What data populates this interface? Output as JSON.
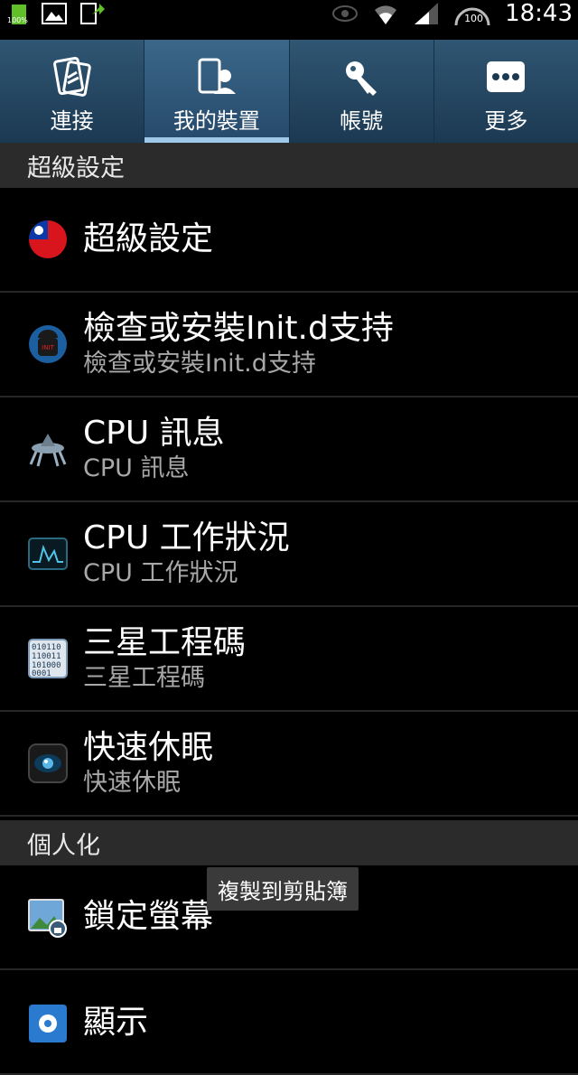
{
  "statusbar": {
    "battery_label": "100%",
    "speed_gauge_value": "100",
    "time": "18:43"
  },
  "tabs": [
    {
      "label": "連接",
      "icon": "connection-icon",
      "active": false
    },
    {
      "label": "我的裝置",
      "icon": "my-device-icon",
      "active": true
    },
    {
      "label": "帳號",
      "icon": "account-key-icon",
      "active": false
    },
    {
      "label": "更多",
      "icon": "more-icon",
      "active": false
    }
  ],
  "sections": {
    "super_settings": "超級設定",
    "personalization": "個人化"
  },
  "items": [
    {
      "title": "超級設定",
      "subtitle": "",
      "icon": "taiwan-flag-icon"
    },
    {
      "title": "檢查或安裝Init.d支持",
      "subtitle": "檢查或安裝Init.d支持",
      "icon": "android-robot-icon"
    },
    {
      "title": "CPU 訊息",
      "subtitle": "CPU 訊息",
      "icon": "cpu-spider-icon"
    },
    {
      "title": "CPU 工作狀況",
      "subtitle": "CPU 工作狀況",
      "icon": "cpu-monitor-icon"
    },
    {
      "title": "三星工程碼",
      "subtitle": "三星工程碼",
      "icon": "binary-code-icon"
    },
    {
      "title": "快速休眠",
      "subtitle": "快速休眠",
      "icon": "sleep-eye-icon"
    },
    {
      "title": "鎖定螢幕",
      "subtitle": "",
      "icon": "lock-screen-icon"
    },
    {
      "title": "顯示",
      "subtitle": "",
      "icon": "display-gear-icon"
    }
  ],
  "toast": "複製到剪貼簿",
  "colors": {
    "tabbar": "#2f5673",
    "active_indicator": "#9ec7e8",
    "section_bg": "#2b2b2b"
  }
}
